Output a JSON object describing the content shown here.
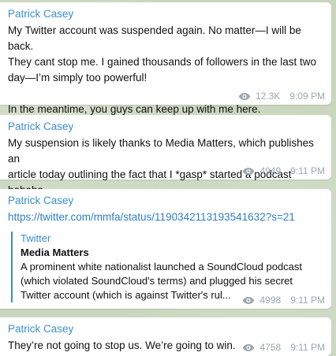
{
  "messages": [
    {
      "author": "Patrick Casey",
      "text_lines": [
        "My Twitter account was suspended again. No matter—I will be back.",
        "They cant stop me. I gained thousands of followers in the last two",
        "day—I’m simply too powerful!",
        "",
        "In the meantime, you guys can keep up with me here."
      ],
      "views": "12.3K",
      "time": "9:09 PM"
    },
    {
      "author": "Patrick Casey",
      "text_lines": [
        "My suspension is likely thanks to Media Matters, which publishes an",
        "article today outlining the fact that I *gasp* started a podcast",
        "hahaha"
      ],
      "views": "4949",
      "time": "9:11 PM"
    },
    {
      "author": "Patrick Casey",
      "link": "https://twitter.com/mmfa/status/1190342113193541632?s=21",
      "preview": {
        "site": "Twitter",
        "title": "Media Matters",
        "desc_lines": [
          "A prominent white nationalist launched a SoundCloud podcast",
          "(which violated SoundCloud's terms) and plugged his secret",
          "Twitter account (which is against Twitter's rul..."
        ]
      },
      "views": "4998",
      "time": "9:11 PM"
    },
    {
      "author": "Patrick Casey",
      "text_lines": [
        "They’re not going to stop us. We’re going to win."
      ],
      "views": "4758",
      "time": "9:11 PM"
    }
  ]
}
